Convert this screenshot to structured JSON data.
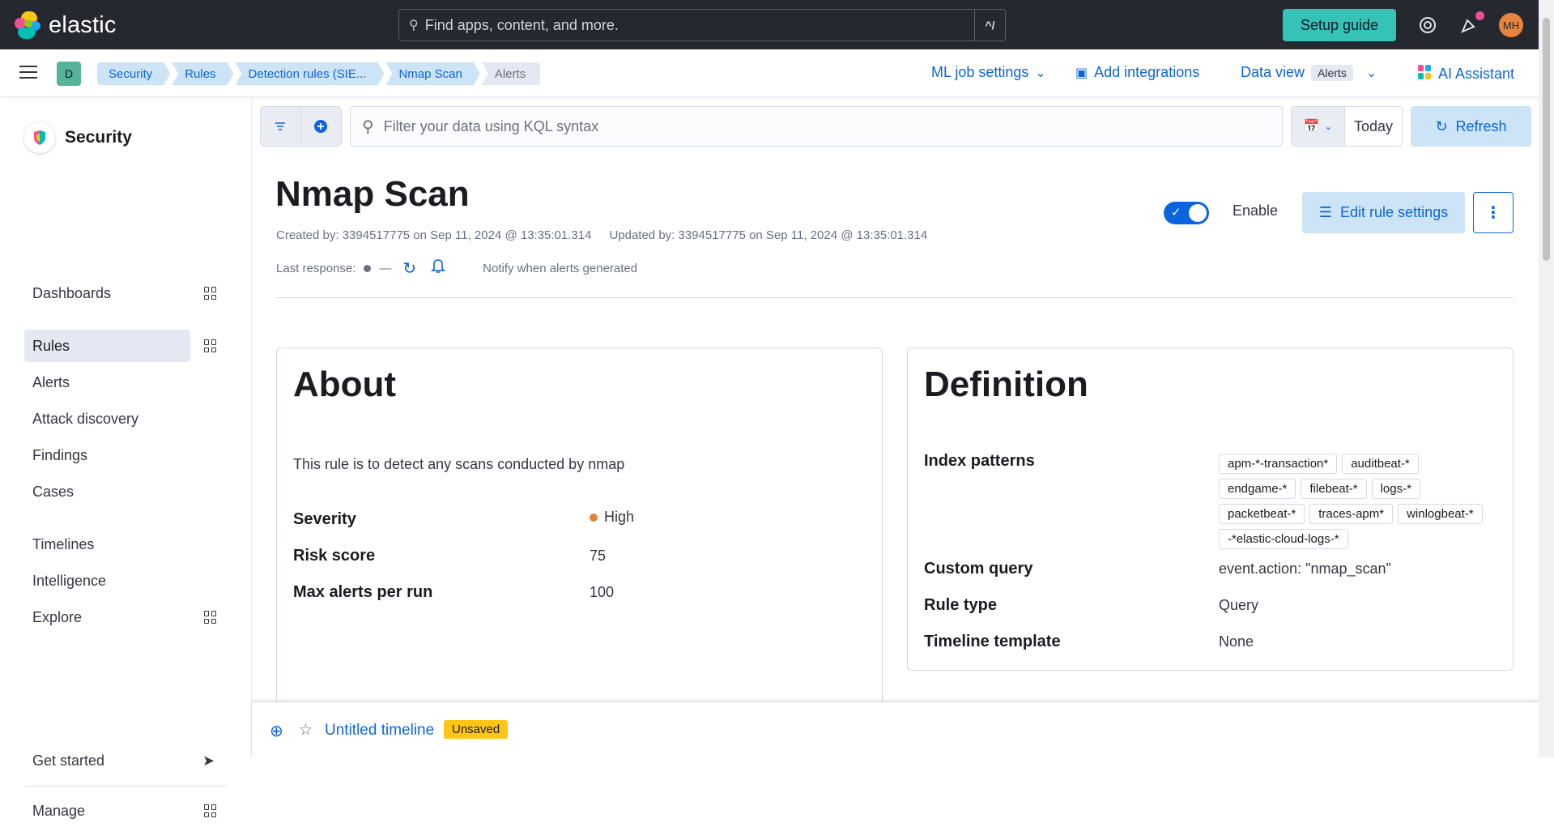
{
  "topbar": {
    "logo_text": "elastic",
    "search_placeholder": "Find apps, content, and more.",
    "search_shortcut": "^/",
    "setup_label": "Setup guide",
    "avatar_initials": "MH",
    "accent_color": "#36c3b7"
  },
  "subbar": {
    "space_letter": "D",
    "breadcrumbs": [
      "Security",
      "Rules",
      "Detection rules (SIE...",
      "Nmap Scan",
      "Alerts"
    ],
    "ml_job_settings": "ML job settings",
    "add_integrations": "Add integrations",
    "data_view_label": "Data view",
    "data_view_value": "Alerts",
    "ai_assistant": "AI Assistant"
  },
  "sidebar": {
    "title": "Security",
    "items": [
      {
        "label": "Dashboards"
      },
      {
        "label": "Rules"
      },
      {
        "label": "Alerts"
      },
      {
        "label": "Attack discovery"
      },
      {
        "label": "Findings"
      },
      {
        "label": "Cases"
      },
      {
        "label": "Timelines"
      },
      {
        "label": "Intelligence"
      },
      {
        "label": "Explore"
      },
      {
        "label": "Get started"
      },
      {
        "label": "Manage"
      }
    ]
  },
  "querybar": {
    "placeholder": "Filter your data using KQL syntax",
    "date_label": "Today",
    "refresh_label": "Refresh"
  },
  "rule": {
    "title": "Nmap Scan",
    "created": "Created by: 3394517775 on Sep 11, 2024 @ 13:35:01.314",
    "updated": "Updated by: 3394517775 on Sep 11, 2024 @ 13:35:01.314",
    "last_response_label": "Last response:",
    "last_response_value": "—",
    "notify_label": "Notify when alerts generated",
    "enable_label": "Enable",
    "edit_label": "Edit rule settings"
  },
  "about": {
    "title": "About",
    "description": "This rule is to detect any scans conducted by nmap",
    "severity_label": "Severity",
    "severity_value": "High",
    "risk_label": "Risk score",
    "risk_value": "75",
    "max_alerts_label": "Max alerts per run",
    "max_alerts_value": "100"
  },
  "definition": {
    "title": "Definition",
    "index_label": "Index patterns",
    "index_patterns": [
      "apm-*-transaction*",
      "auditbeat-*",
      "endgame-*",
      "filebeat-*",
      "logs-*",
      "packetbeat-*",
      "traces-apm*",
      "winlogbeat-*",
      "-*elastic-cloud-logs-*"
    ],
    "query_label": "Custom query",
    "query_value": "event.action: \"nmap_scan\"",
    "rule_type_label": "Rule type",
    "rule_type_value": "Query",
    "timeline_label": "Timeline template",
    "timeline_value": "None"
  },
  "timeline": {
    "name": "Untitled timeline",
    "badge": "Unsaved"
  }
}
